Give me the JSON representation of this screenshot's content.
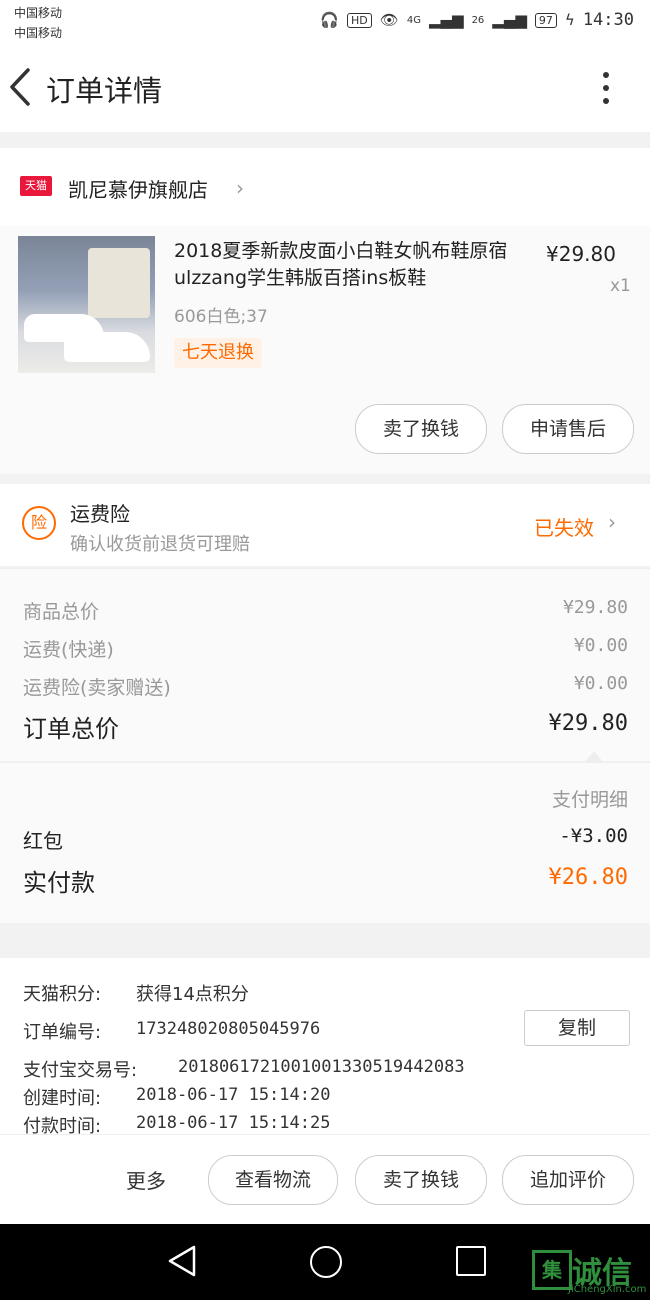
{
  "status_bar": {
    "carrier_1": "中国移动",
    "carrier_2": "中国移动",
    "hd": "HD",
    "net_1": "4G",
    "net_2": "26",
    "battery": "97",
    "time": "14:30"
  },
  "header": {
    "title": "订单详情"
  },
  "shop": {
    "badge": "天猫",
    "name": "凯尼慕伊旗舰店"
  },
  "product": {
    "title": "2018夏季新款皮面小白鞋女帆布鞋原宿ulzzang学生韩版百搭ins板鞋",
    "price": "¥29.80",
    "quantity": "x1",
    "sku": "606白色;37",
    "return_tag": "七天退换"
  },
  "product_actions": {
    "sell_swap": "卖了换钱",
    "after_sale": "申请售后"
  },
  "insurance": {
    "icon_text": "险",
    "title": "运费险",
    "subtitle": "确认收货前退货可理赔",
    "status": "已失效"
  },
  "summary": {
    "goods_label": "商品总价",
    "goods_value": "¥29.80",
    "shipping_label": "运费(快递)",
    "shipping_value": "¥0.00",
    "insurance_label": "运费险(卖家赠送)",
    "insurance_value": "¥0.00",
    "total_label": "订单总价",
    "total_value": "¥29.80"
  },
  "payment": {
    "detail_label": "支付明细",
    "redpack_label": "红包",
    "redpack_value": "-¥3.00",
    "actual_label": "实付款",
    "actual_value": "¥26.80"
  },
  "order_info": {
    "points_label": "天猫积分:",
    "points_value": "获得14点积分",
    "order_no_label": "订单编号:",
    "order_no_value": "173248020805045976",
    "copy_button": "复制",
    "alipay_label": "支付宝交易号:",
    "alipay_value": "2018061721001001330519442083",
    "created_label": "创建时间:",
    "created_value": "2018-06-17 15:14:20",
    "paid_label": "付款时间:",
    "paid_value": "2018-06-17 15:14:25"
  },
  "bottom_actions": {
    "more": "更多",
    "logistics": "查看物流",
    "sell_swap": "卖了换钱",
    "review": "追加评价"
  },
  "watermark": {
    "box": "集",
    "text": "诚信",
    "url": "JiChengXin.com"
  },
  "colors": {
    "accent": "#ff6a00",
    "tmall_red": "#e8173b",
    "watermark_green": "#2f8f3c"
  }
}
